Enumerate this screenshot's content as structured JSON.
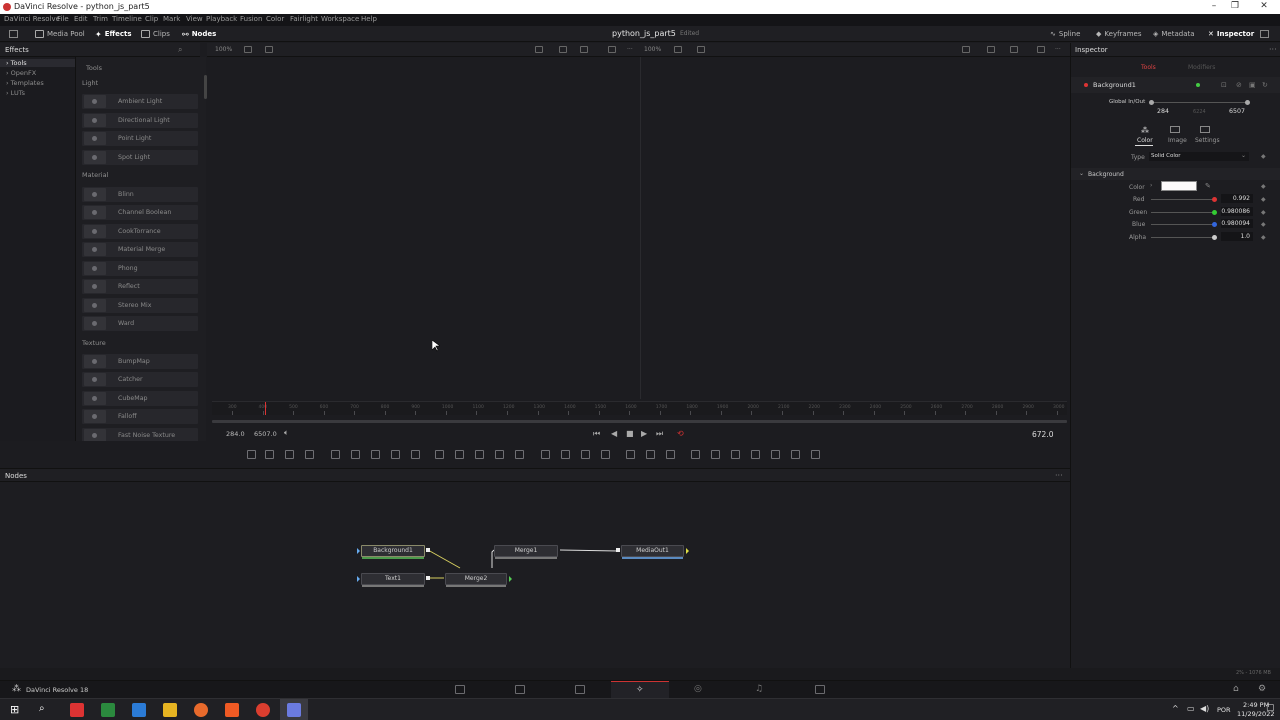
{
  "window": {
    "title": "DaVinci Resolve - python_js_part5"
  },
  "menu": [
    "DaVinci Resolve",
    "File",
    "Edit",
    "Trim",
    "Timeline",
    "Clip",
    "Mark",
    "View",
    "Playback",
    "Fusion",
    "Color",
    "Fairlight",
    "Workspace",
    "Help"
  ],
  "toolbar": {
    "media_pool": "Media Pool",
    "effects": "Effects",
    "clips": "Clips",
    "nodes": "Nodes",
    "project_title": "python_js_part5",
    "project_status": "Edited",
    "spline": "Spline",
    "keyframes": "Keyframes",
    "metadata": "Metadata",
    "inspector": "Inspector"
  },
  "effects_panel": {
    "header": "Effects",
    "tree": [
      "Tools",
      "OpenFX",
      "Templates",
      "LUTs"
    ],
    "list_header": "Tools",
    "categories": [
      {
        "name": "Light",
        "items": [
          "Ambient Light",
          "Directional Light",
          "Point Light",
          "Spot Light"
        ]
      },
      {
        "name": "Material",
        "items": [
          "Blinn",
          "Channel Boolean",
          "CookTorrance",
          "Material Merge",
          "Phong",
          "Reflect",
          "Stereo Mix",
          "Ward"
        ]
      },
      {
        "name": "Texture",
        "items": [
          "BumpMap",
          "Catcher",
          "CubeMap",
          "Falloff",
          "Fast Noise Texture"
        ]
      }
    ]
  },
  "viewer": {
    "zoom_left": "100%",
    "zoom_right": "100%",
    "ruler_labels": [
      "300",
      "400",
      "500",
      "600",
      "700",
      "800",
      "900",
      "1000",
      "1100",
      "1200",
      "1300",
      "1400",
      "1500",
      "1600",
      "1700",
      "1800",
      "1900",
      "2000",
      "2100",
      "2200",
      "2300",
      "2400",
      "2500",
      "2600",
      "2700",
      "2800",
      "2900",
      "3000"
    ],
    "start_frame": "284.0",
    "end_frame": "6507.0",
    "current_frame": "672.0"
  },
  "nodes_panel": {
    "header": "Nodes",
    "nodes": [
      "Background1",
      "Text1",
      "Merge1",
      "Merge2",
      "MediaOut1"
    ]
  },
  "inspector": {
    "header": "Inspector",
    "tab_tools": "Tools",
    "tab_modifiers": "Modifiers",
    "node_name": "Background1",
    "global_inout_label": "Global In/Out",
    "global_in": "284",
    "global_mid": "6224",
    "global_out": "6507",
    "subtabs": [
      "Color",
      "Image",
      "Settings"
    ],
    "type_label": "Type",
    "type_value": "Solid Color",
    "section": "Background",
    "color_label": "Color",
    "channels": [
      {
        "label": "Red",
        "value": "0.992",
        "color": "#d33"
      },
      {
        "label": "Green",
        "value": "0.980086",
        "color": "#3c3"
      },
      {
        "label": "Blue",
        "value": "0.980094",
        "color": "#36d"
      },
      {
        "label": "Alpha",
        "value": "1.0",
        "color": "#ccc"
      }
    ]
  },
  "footer": {
    "app_name": "DaVinci Resolve 18",
    "memory": "2% - 1076 MB"
  },
  "taskbar": {
    "language": "POR",
    "time": "2:49 PM",
    "date": "11/29/2022"
  }
}
